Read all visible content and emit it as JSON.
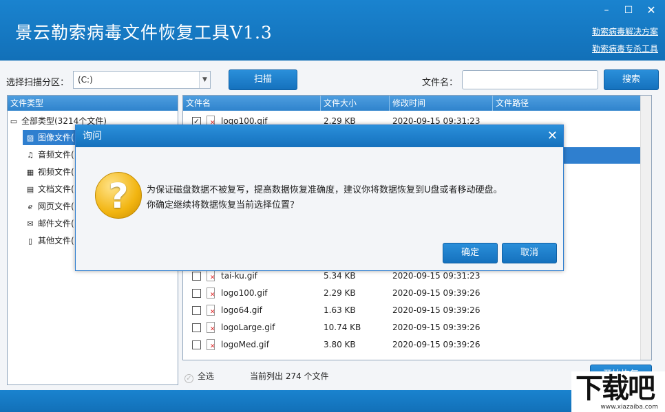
{
  "window": {
    "title": "景云勒索病毒文件恢复工具V1.3",
    "links": [
      "勒索病毒解决方案",
      "勒索病毒专杀工具"
    ],
    "controls": {
      "minimize": "–",
      "maximize": "☐",
      "close": "✕"
    }
  },
  "toolbar": {
    "partition_label": "选择扫描分区：",
    "partition_value": "(C:)",
    "scan_button": "扫描",
    "filename_label": "文件名：",
    "filename_value": "",
    "search_button": "搜索"
  },
  "left_panel": {
    "header": "文件类型",
    "root": "全部类型(3214个文件)",
    "items": [
      {
        "label": "图像文件(",
        "icon": "image-file-icon",
        "glyph": "▨"
      },
      {
        "label": "音频文件(",
        "icon": "audio-file-icon",
        "glyph": "♫"
      },
      {
        "label": "视频文件(",
        "icon": "video-file-icon",
        "glyph": "▦"
      },
      {
        "label": "文档文件(",
        "icon": "document-file-icon",
        "glyph": "▤"
      },
      {
        "label": "网页文件(",
        "icon": "web-file-icon",
        "glyph": "ℯ"
      },
      {
        "label": "邮件文件(",
        "icon": "mail-file-icon",
        "glyph": "✉"
      },
      {
        "label": "其他文件(",
        "icon": "other-file-icon",
        "glyph": "▯"
      }
    ]
  },
  "table": {
    "columns": [
      "文件名",
      "文件大小",
      "修改时间",
      "文件路径"
    ],
    "rows_top": [
      {
        "name": "logo100.gif",
        "size": "2.29 KB",
        "date": "2020-09-15  09:31:23",
        "checked": true
      }
    ],
    "rows_bottom": [
      {
        "name": "tai-ku.gif",
        "size": "5.34 KB",
        "date": "2020-09-15  09:31:23",
        "checked": false
      },
      {
        "name": "logo100.gif",
        "size": "2.29 KB",
        "date": "2020-09-15  09:39:26",
        "checked": false
      },
      {
        "name": "logo64.gif",
        "size": "1.63 KB",
        "date": "2020-09-15  09:39:26",
        "checked": false
      },
      {
        "name": "logoLarge.gif",
        "size": "10.74 KB",
        "date": "2020-09-15  09:39:26",
        "checked": false
      },
      {
        "name": "logoMed.gif",
        "size": "3.80 KB",
        "date": "2020-09-15  09:39:26",
        "checked": false
      }
    ]
  },
  "bottom": {
    "select_all": "全选",
    "count_text": "当前列出 274 个文件",
    "recover_button": "开始恢复"
  },
  "dialog": {
    "title": "询问",
    "line1": "为保证磁盘数据不被复写，提高数据恢复准确度，建议你将数据恢复到U盘或者移动硬盘。",
    "line2": "你确定继续将数据恢复当前选择位置？",
    "ok": "确定",
    "cancel": "取消"
  },
  "watermark": {
    "big": "下载吧",
    "small": "www.xiazaiba.com"
  },
  "colors": {
    "primary": "#1571bd",
    "header_blue": "#2f83cc",
    "selected": "#2f7fcf"
  }
}
